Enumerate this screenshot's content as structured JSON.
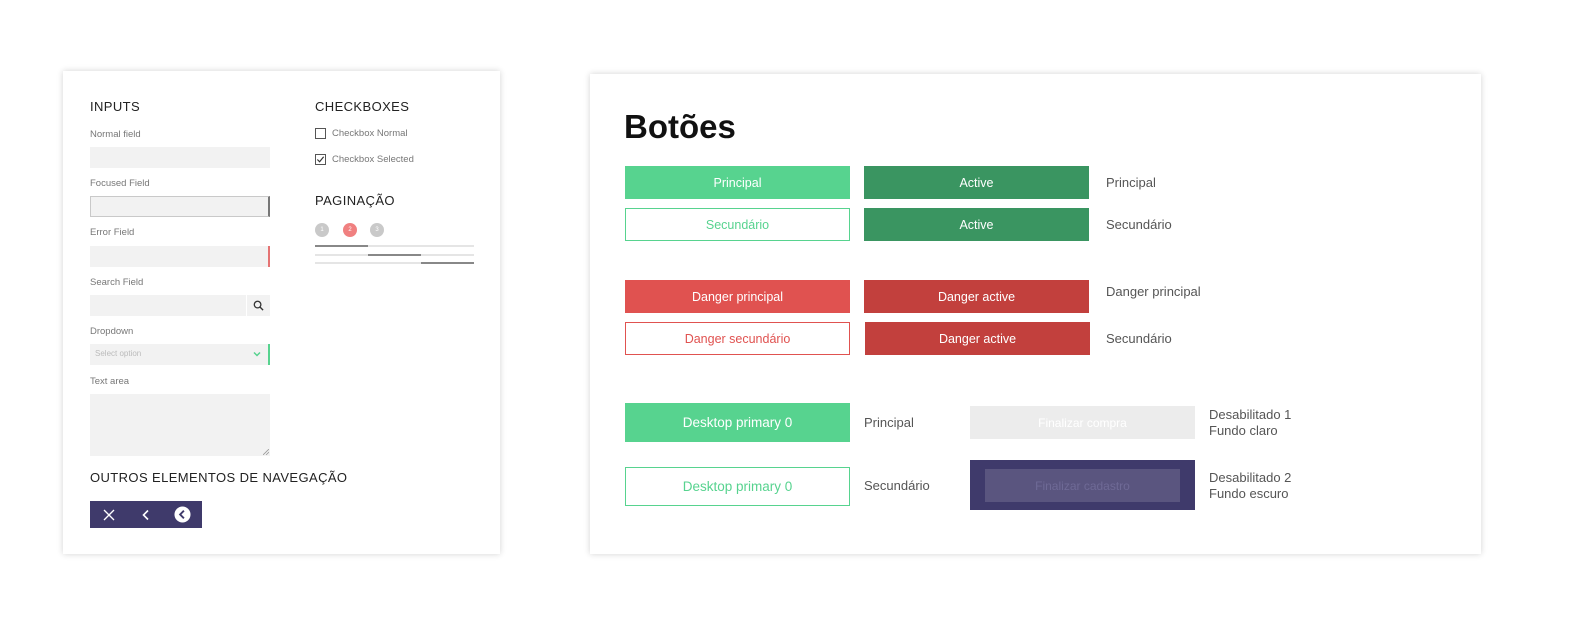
{
  "left": {
    "inputs_heading": "INPUTS",
    "normal_field_label": "Normal field",
    "focused_field_label": "Focused Field",
    "error_field_label": "Error Field",
    "search_field_label": "Search Field",
    "dropdown_label": "Dropdown",
    "dropdown_placeholder": "Select option",
    "textarea_label": "Text area",
    "checkboxes_heading": "CHECKBOXES",
    "checkbox_normal_label": "Checkbox Normal",
    "checkbox_selected_label": "Checkbox Selected",
    "pagination_heading": "PAGINAÇÃO",
    "pages": [
      "1",
      "2",
      "3"
    ],
    "active_page": "2",
    "nav_heading": "OUTROS ELEMENTOS DE NAVEGAÇÃO"
  },
  "right": {
    "title": "Botões",
    "row1": {
      "primary": "Principal",
      "active": "Active",
      "label": "Principal"
    },
    "row2": {
      "secondary": "Secundário",
      "active": "Active",
      "label": "Secundário"
    },
    "row3": {
      "primary": "Danger principal",
      "active": "Danger active",
      "label": "Danger principal"
    },
    "row4": {
      "secondary": "Danger secundário",
      "active": "Danger active",
      "label": "Secundário"
    },
    "row5": {
      "button": "Desktop primary 0",
      "label": "Principal",
      "disabled": "Finalizar compra",
      "desc1": "Desabilitado 1",
      "desc2": "Fundo claro"
    },
    "row6": {
      "button": "Desktop primary 0",
      "label": "Secundário",
      "disabled": "Finalizar cadastro",
      "desc1": "Desabilitado 2",
      "desc2": "Fundo escuro"
    }
  },
  "colors": {
    "green": "#57d38f",
    "green_active": "#3a9561",
    "danger": "#e05250",
    "danger_active": "#c2403d",
    "navy": "#3f3a6b"
  },
  "icons": [
    "search-icon",
    "chevron-down-icon",
    "check-icon",
    "close-icon",
    "chevron-left-icon",
    "back-circle-icon"
  ]
}
